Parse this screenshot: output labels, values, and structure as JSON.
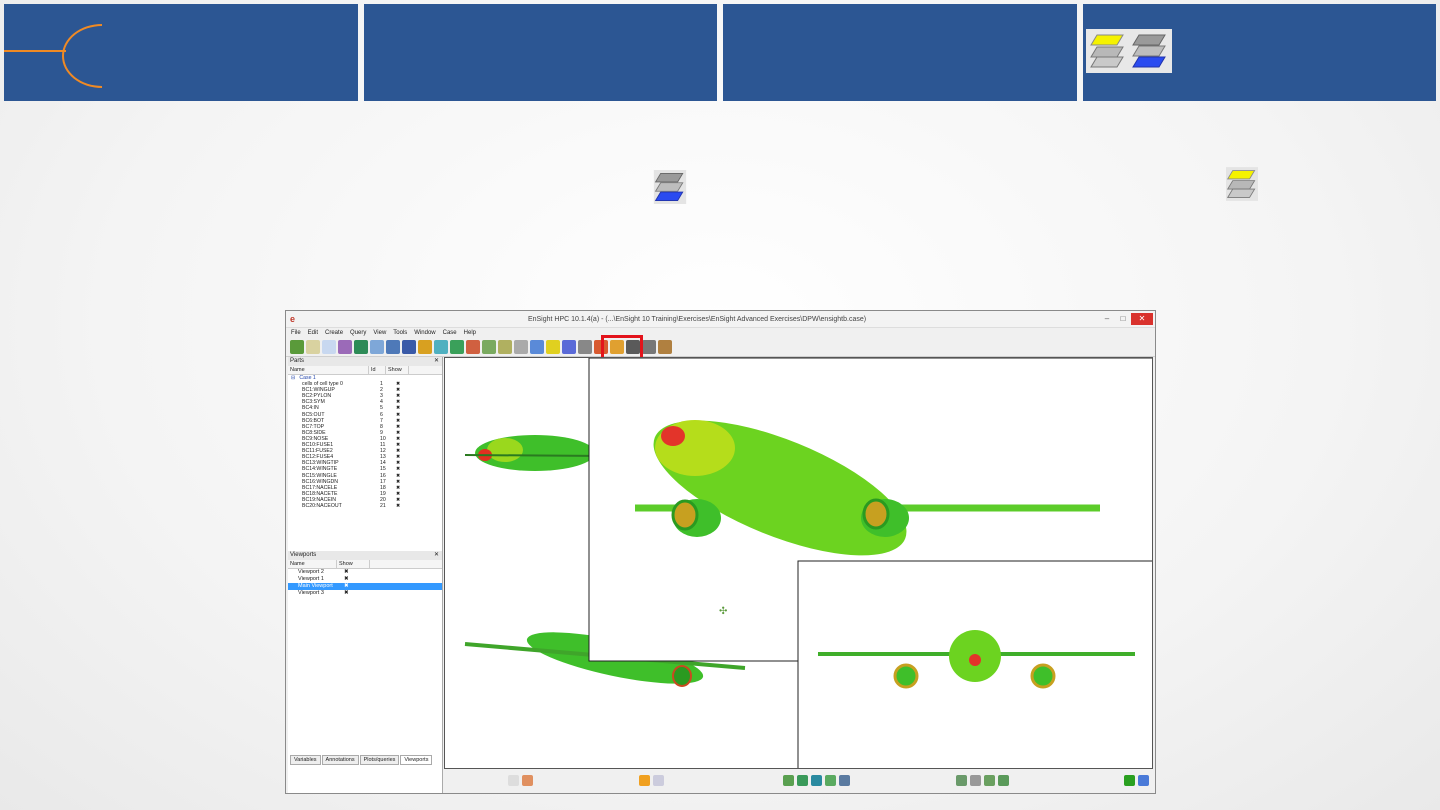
{
  "app": {
    "title": "EnSight HPC 10.1.4(a) - (...\\EnSight 10 Training\\Exercises\\EnSight Advanced Exercises\\DPW\\ensightb.case)",
    "menu": [
      "File",
      "Edit",
      "Create",
      "Query",
      "View",
      "Tools",
      "Window",
      "Case",
      "Help"
    ]
  },
  "parts_panel": {
    "title": "Parts",
    "columns": [
      "Name",
      "Id",
      "Show"
    ],
    "case_label": "Case 1",
    "rows": [
      {
        "name": "cells of cell type 0",
        "id": "1"
      },
      {
        "name": "BC1:WINGUP",
        "id": "2"
      },
      {
        "name": "BC2:PYLON",
        "id": "3"
      },
      {
        "name": "BC3:SYM",
        "id": "4"
      },
      {
        "name": "BC4:IN",
        "id": "5"
      },
      {
        "name": "BC5:OUT",
        "id": "6"
      },
      {
        "name": "BC6:BOT",
        "id": "7"
      },
      {
        "name": "BC7:TOP",
        "id": "8"
      },
      {
        "name": "BC8:SIDE",
        "id": "9"
      },
      {
        "name": "BC9:NOSE",
        "id": "10"
      },
      {
        "name": "BC10:FUSE1",
        "id": "11"
      },
      {
        "name": "BC11:FUSE2",
        "id": "12"
      },
      {
        "name": "BC12:FUSE4",
        "id": "13"
      },
      {
        "name": "BC13:WINGTIP",
        "id": "14"
      },
      {
        "name": "BC14:WINGTE",
        "id": "15"
      },
      {
        "name": "BC15:WINGLE",
        "id": "16"
      },
      {
        "name": "BC16:WINGDN",
        "id": "17"
      },
      {
        "name": "BC17:NACELE",
        "id": "18"
      },
      {
        "name": "BC18:NACETE",
        "id": "19"
      },
      {
        "name": "BC19:NACEIN",
        "id": "20"
      },
      {
        "name": "BC20:NACEOUT",
        "id": "21"
      }
    ]
  },
  "viewports_panel": {
    "title": "Viewports",
    "columns": [
      "Name",
      "Show"
    ],
    "rows": [
      {
        "name": "Viewport 2",
        "selected": false
      },
      {
        "name": "Viewport 1",
        "selected": false
      },
      {
        "name": "Main Viewport",
        "selected": true
      },
      {
        "name": "Viewport 3",
        "selected": false
      }
    ]
  },
  "bottom_tabs": [
    "Variables",
    "Annotations",
    "Plots/queries",
    "Viewports"
  ],
  "colors": {
    "banner": "#2c5693",
    "accent_orange": "#f08a24",
    "highlight": "#e3131b",
    "selection": "#3399ff"
  },
  "icons": {
    "layer_front": "layer-stack-yellow-top-icon",
    "layer_back": "layer-stack-blue-bottom-icon"
  }
}
